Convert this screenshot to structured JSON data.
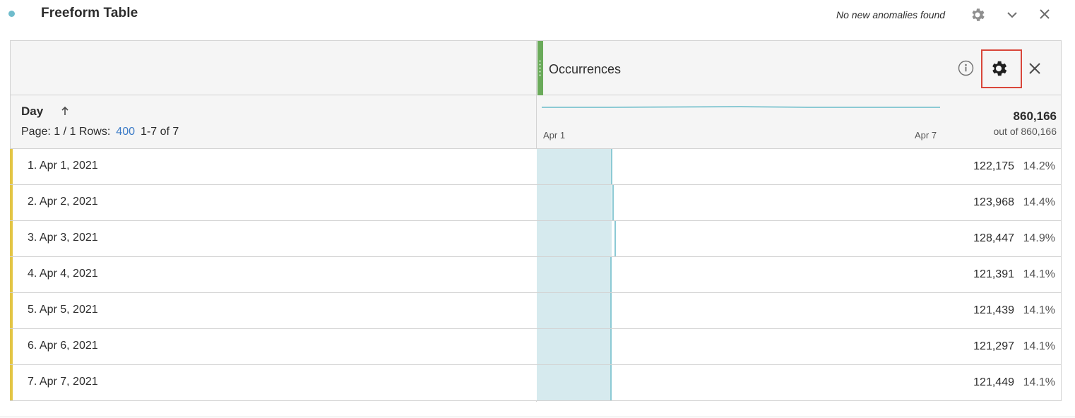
{
  "panel": {
    "title": "Freeform Table",
    "anomalies": "No new anomalies found"
  },
  "metric": {
    "name": "Occurrences",
    "total": "860,166",
    "total_sub": "out of 860,166",
    "sparkline_start": "Apr 1",
    "sparkline_end": "Apr 7"
  },
  "dimension": {
    "name": "Day",
    "page_label": "Page: 1 / 1 Rows:",
    "rows_value": "400",
    "range": "1-7 of 7"
  },
  "rows": [
    {
      "label": "1. Apr 1, 2021",
      "value": "122,175",
      "pct": "14.2%",
      "share": 0.142
    },
    {
      "label": "2. Apr 2, 2021",
      "value": "123,968",
      "pct": "14.4%",
      "share": 0.144
    },
    {
      "label": "3. Apr 3, 2021",
      "value": "128,447",
      "pct": "14.9%",
      "share": 0.149
    },
    {
      "label": "4. Apr 4, 2021",
      "value": "121,391",
      "pct": "14.1%",
      "share": 0.141
    },
    {
      "label": "5. Apr 5, 2021",
      "value": "121,439",
      "pct": "14.1%",
      "share": 0.141
    },
    {
      "label": "6. Apr 6, 2021",
      "value": "121,297",
      "pct": "14.1%",
      "share": 0.141
    },
    {
      "label": "7. Apr 7, 2021",
      "value": "121,449",
      "pct": "14.1%",
      "share": 0.141
    }
  ],
  "colors": {
    "accent_dot": "#6fbccc",
    "metric_grip": "#6aaa5a",
    "row_accent": "#e3c545",
    "bar_fill": "#d6eaee",
    "highlight_box": "#d9463a",
    "link": "#3c7bc7"
  },
  "icons": {
    "panel_settings": "gear-icon",
    "panel_collapse": "chevron-down-icon",
    "panel_close": "close-icon",
    "metric_info": "info-icon",
    "metric_settings": "gear-icon",
    "metric_remove": "close-icon",
    "sort": "arrow-up-icon"
  }
}
